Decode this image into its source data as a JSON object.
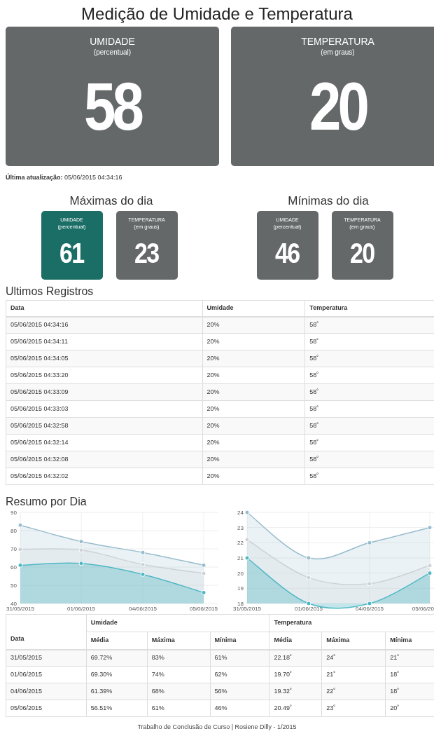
{
  "title": "Medição de Umidade e Temperatura",
  "current": [
    {
      "label": "UMIDADE",
      "unit": "(percentual)",
      "value": "58"
    },
    {
      "label": "TEMPERATURA",
      "unit": "(em graus)",
      "value": "20"
    }
  ],
  "last_update": {
    "label": "Última atualização:",
    "value": "05/06/2015 04:34:16"
  },
  "daily": [
    {
      "title": "Máximas do dia",
      "cards": [
        {
          "label": "UMIDADE",
          "unit": "(percentual)",
          "value": "61",
          "color": "#1b6e66"
        },
        {
          "label": "TEMPERATURA",
          "unit": "(em graus)",
          "value": "23",
          "color": "#646869"
        }
      ]
    },
    {
      "title": "Mínimas do dia",
      "cards": [
        {
          "label": "UMIDADE",
          "unit": "(percentual)",
          "value": "46",
          "color": "#646869"
        },
        {
          "label": "TEMPERATURA",
          "unit": "(em graus)",
          "value": "20",
          "color": "#646869"
        }
      ]
    }
  ],
  "records": {
    "title": "Ultimos Registros",
    "columns": [
      "Data",
      "Umidade",
      "Temperatura"
    ],
    "rows": [
      [
        "05/06/2015 04:34:16",
        "20%",
        "58˚"
      ],
      [
        "05/06/2015 04:34:11",
        "20%",
        "58˚"
      ],
      [
        "05/06/2015 04:34:05",
        "20%",
        "58˚"
      ],
      [
        "05/06/2015 04:33:20",
        "20%",
        "58˚"
      ],
      [
        "05/06/2015 04:33:09",
        "20%",
        "58˚"
      ],
      [
        "05/06/2015 04:33:03",
        "20%",
        "58˚"
      ],
      [
        "05/06/2015 04:32:58",
        "20%",
        "58˚"
      ],
      [
        "05/06/2015 04:32:14",
        "20%",
        "58˚"
      ],
      [
        "05/06/2015 04:32:08",
        "20%",
        "58˚"
      ],
      [
        "05/06/2015 04:32:02",
        "20%",
        "58˚"
      ]
    ]
  },
  "summary": {
    "title": "Resumo por Dia",
    "charts": [
      {
        "chart_data": {
          "type": "area",
          "grid": true,
          "categories": [
            "31/05/2015",
            "01/06/2015",
            "04/06/2015",
            "05/06/2015"
          ],
          "ylim": [
            40,
            90
          ],
          "yticks": [
            40,
            50,
            60,
            70,
            80,
            90
          ],
          "series": [
            {
              "color": "#97bccd",
              "values": [
                83,
                74,
                68,
                61
              ]
            },
            {
              "color": "#cdd2d8",
              "values": [
                69.7,
                69.3,
                61.4,
                56.5
              ]
            },
            {
              "color": "#4fb8c4",
              "values": [
                61,
                62,
                56,
                46
              ]
            }
          ]
        }
      },
      {
        "chart_data": {
          "type": "area",
          "grid": true,
          "categories": [
            "31/05/2015",
            "01/06/2015",
            "04/06/2015",
            "05/06/20"
          ],
          "ylim": [
            18,
            24
          ],
          "yticks": [
            18,
            19,
            20,
            21,
            22,
            23,
            24
          ],
          "series": [
            {
              "color": "#97bccd",
              "values": [
                24,
                21,
                22,
                23
              ]
            },
            {
              "color": "#cdd2d8",
              "values": [
                22.2,
                19.7,
                19.3,
                20.5
              ]
            },
            {
              "color": "#4fb8c4",
              "values": [
                21,
                18,
                18,
                20
              ]
            }
          ]
        }
      }
    ],
    "table": {
      "date_column": "Data",
      "groups": [
        {
          "label": "Umidade",
          "columns": [
            "Média",
            "Máxima",
            "Mínima"
          ]
        },
        {
          "label": "Temperatura",
          "columns": [
            "Média",
            "Máxima",
            "Mínima"
          ]
        }
      ],
      "rows": [
        [
          "31/05/2015",
          "69.72%",
          "83%",
          "61%",
          "22.18˚",
          "24˚",
          "21˚"
        ],
        [
          "01/06/2015",
          "69.30%",
          "74%",
          "62%",
          "19.70˚",
          "21˚",
          "18˚"
        ],
        [
          "04/06/2015",
          "61.39%",
          "68%",
          "56%",
          "19.32˚",
          "22˚",
          "18˚"
        ],
        [
          "05/06/2015",
          "56.51%",
          "61%",
          "46%",
          "20.49˚",
          "23˚",
          "20˚"
        ]
      ]
    }
  },
  "footer": "Trabalho de Conclusão de Curso | Rosiene Dilly - 1/2015"
}
